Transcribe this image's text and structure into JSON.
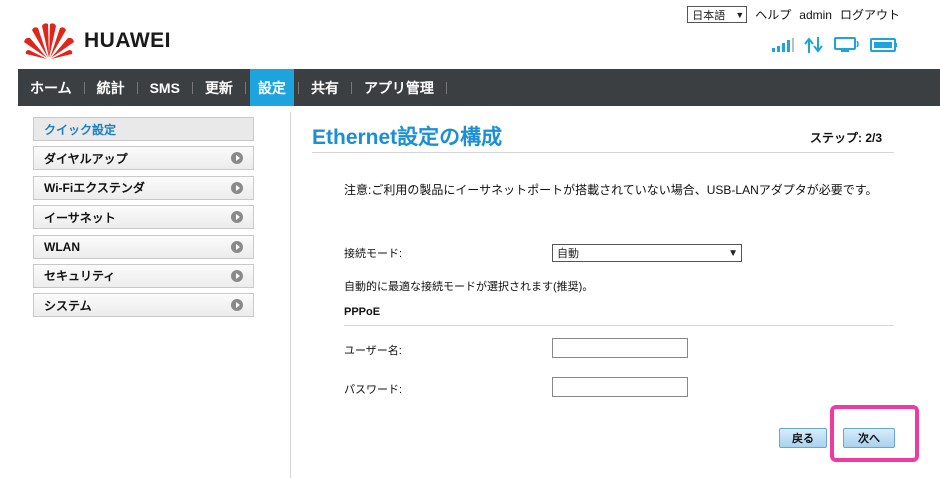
{
  "header": {
    "brand": "HUAWEI",
    "language": "日本語",
    "help": "ヘルプ",
    "user": "admin",
    "logout": "ログアウト",
    "status_icons": [
      "signal-icon",
      "data-transfer-icon",
      "monitor-icon",
      "battery-icon"
    ]
  },
  "nav": {
    "items": [
      {
        "label": "ホーム"
      },
      {
        "label": "統計"
      },
      {
        "label": "SMS"
      },
      {
        "label": "更新"
      },
      {
        "label": "設定",
        "active": true
      },
      {
        "label": "共有"
      },
      {
        "label": "アプリ管理"
      }
    ]
  },
  "sidebar": {
    "items": [
      {
        "label": "クイック設定",
        "active": true
      },
      {
        "label": "ダイヤルアップ"
      },
      {
        "label": "Wi-Fiエクステンダ"
      },
      {
        "label": "イーサネット"
      },
      {
        "label": "WLAN"
      },
      {
        "label": "セキュリティ"
      },
      {
        "label": "システム"
      }
    ]
  },
  "main": {
    "title": "Ethernet設定の構成",
    "step": "ステップ: 2/3",
    "notice": "注意:ご利用の製品にイーサネットポートが搭載されていない場合、USB-LANアダプタが必要です。",
    "mode_label": "接続モード:",
    "mode_value": "自動",
    "hint": "自動的に最適な接続モードが選択されます(推奨)。",
    "section": "PPPoE",
    "username_label": "ユーザー名:",
    "username_value": "",
    "password_label": "パスワード:",
    "password_value": "",
    "back_button": "戻る",
    "next_button": "次へ"
  },
  "colors": {
    "accent": "#1da4dd",
    "nav_bg": "#3c3f42",
    "title": "#1a8fd4",
    "highlight": "#ee3aa2",
    "logo_red": "#e1251b"
  }
}
